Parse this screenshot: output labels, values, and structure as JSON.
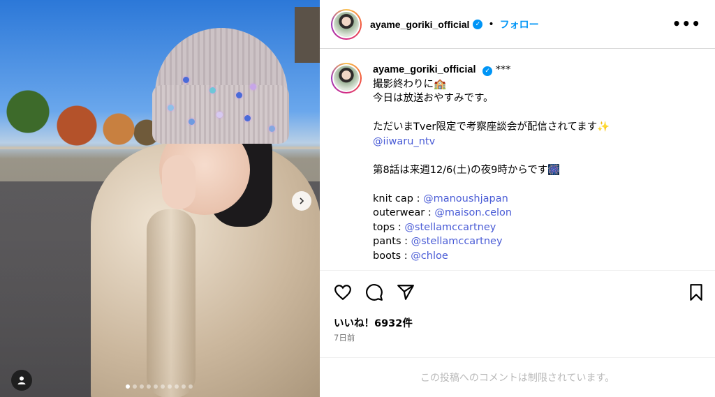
{
  "post": {
    "username": "ayame_goriki_official",
    "follow_label": "フォロー",
    "more_label": "•••",
    "separator": "•"
  },
  "caption": {
    "username": "ayame_goriki_official",
    "suffix": "***",
    "lines": [
      "撮影終わりに🏫",
      "今日は放送おやすみです。",
      "",
      "ただいまTver限定で考察座談会が配信されてます✨",
      "@iiwaru_ntv",
      "",
      "第8話は来週12/6(土)の夜9時からです🎆",
      "",
      "knit cap : ",
      "outerwear : ",
      "tops : ",
      "pants : ",
      "boots : "
    ],
    "mentions": {
      "knit_cap": "@manoushjapan",
      "outerwear": "@maison.celon",
      "tops": "@stellamccartney",
      "pants": "@stellamccartney",
      "boots": "@chloe"
    }
  },
  "stats": {
    "likes": "いいね！6932件",
    "time": "7日前"
  },
  "comments_disabled": "この投稿へのコメントは制限されています。",
  "carousel": {
    "total": 10,
    "current": 1
  },
  "icons": {
    "like": "heart-icon",
    "comment": "comment-icon",
    "share": "paper-plane-icon",
    "save": "bookmark-icon",
    "next": "chevron-right-icon",
    "tag": "user-tag-icon",
    "verified": "verified-badge-icon"
  },
  "colors": {
    "link": "#4a5cd6",
    "follow": "#0095f6",
    "verified": "#0095f6"
  }
}
